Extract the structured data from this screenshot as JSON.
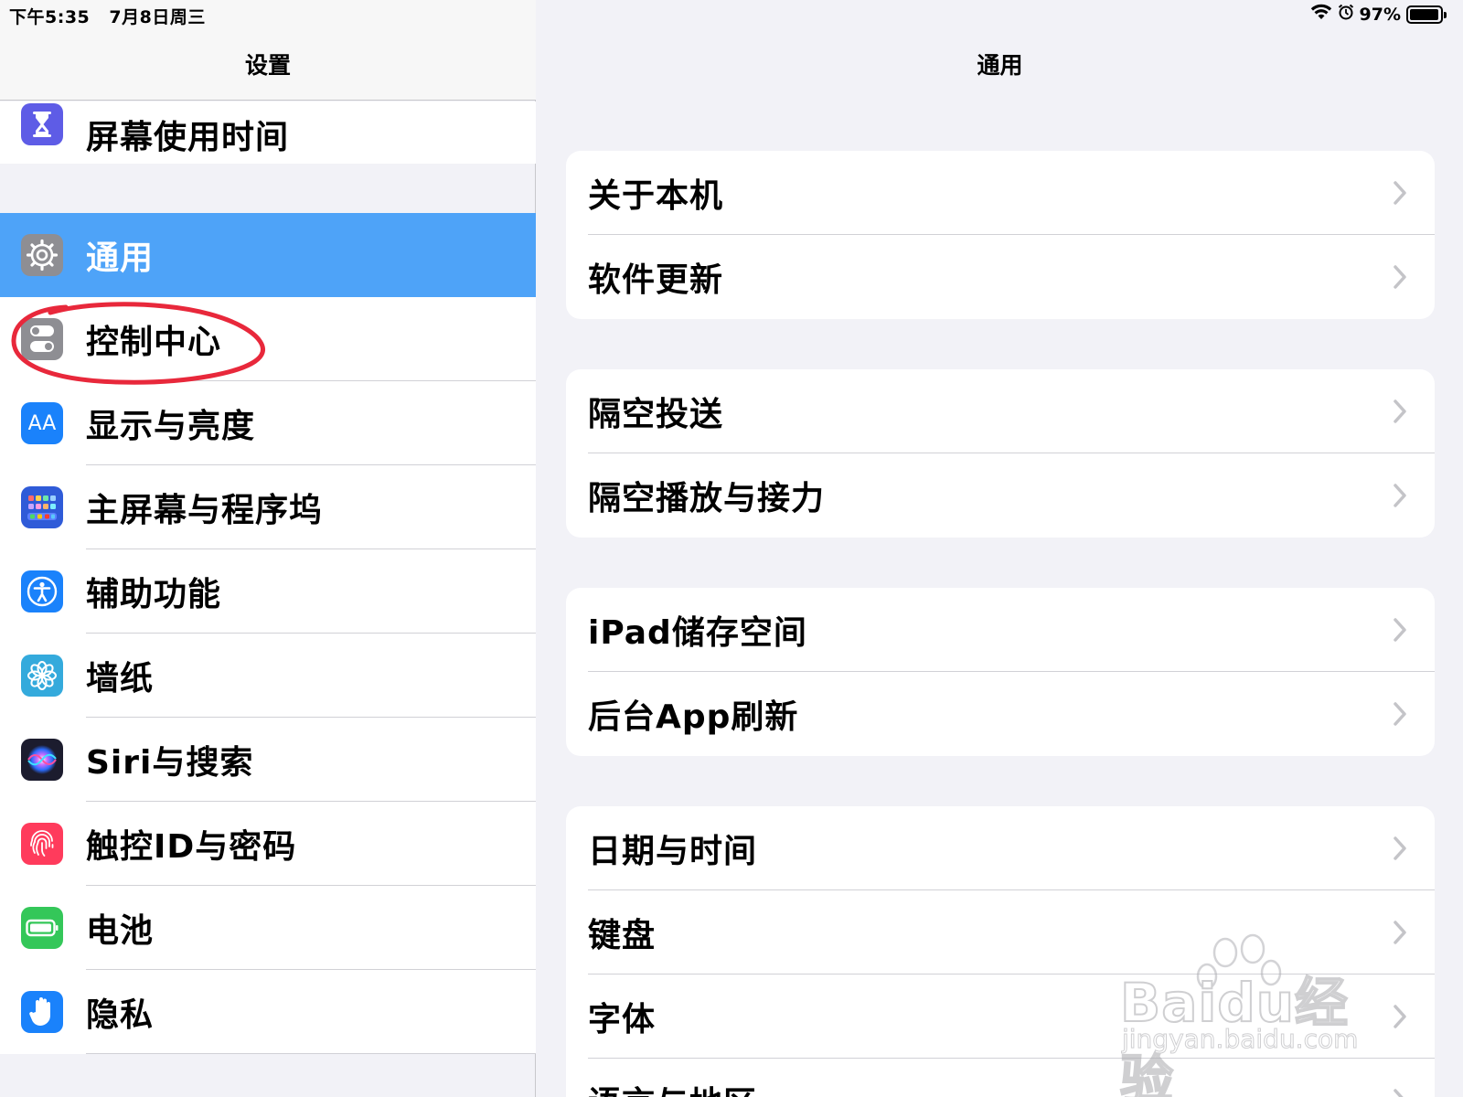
{
  "status_bar": {
    "time": "下午5:35",
    "date": "7月8日周三",
    "battery_percent": "97%",
    "battery_level": 0.97
  },
  "left": {
    "title": "设置",
    "top_item": {
      "label": "屏幕使用时间",
      "icon": "hourglass-icon"
    },
    "items": [
      {
        "label": "通用",
        "icon": "gear-icon",
        "selected": true
      },
      {
        "label": "控制中心",
        "icon": "toggles-icon"
      },
      {
        "label": "显示与亮度",
        "icon": "text-size-icon",
        "icon_text": "AA"
      },
      {
        "label": "主屏幕与程序坞",
        "icon": "app-grid-icon"
      },
      {
        "label": "辅助功能",
        "icon": "accessibility-icon"
      },
      {
        "label": "墙纸",
        "icon": "flower-icon"
      },
      {
        "label": "Siri与搜索",
        "icon": "siri-icon"
      },
      {
        "label": "触控ID与密码",
        "icon": "fingerprint-icon"
      },
      {
        "label": "电池",
        "icon": "battery-icon"
      },
      {
        "label": "隐私",
        "icon": "hand-icon"
      }
    ]
  },
  "right": {
    "title": "通用",
    "groups": [
      [
        "关于本机",
        "软件更新"
      ],
      [
        "隔空投送",
        "隔空播放与接力"
      ],
      [
        "iPad储存空间",
        "后台App刷新"
      ],
      [
        "日期与时间",
        "键盘",
        "字体",
        "语言与地区"
      ]
    ]
  },
  "watermark": {
    "brand": "Baidu经验",
    "url": "jingyan.baidu.com"
  },
  "colors": {
    "selected_row": "#4ea3f8",
    "annotation": "#e8283b",
    "screen_time_icon": "#5e5ce6",
    "general_icon": "#8e8e93",
    "control_center_icon": "#8e8e93",
    "display_icon": "#1a82fb",
    "home_icon": "#2f5bd8",
    "accessibility_icon": "#1a82fb",
    "wallpaper_icon": "#34aadc",
    "siri_icon": "#1c1c2e",
    "touch_id_icon": "#ff3b5c",
    "battery_icon": "#34c759",
    "privacy_icon": "#1a82fb"
  }
}
